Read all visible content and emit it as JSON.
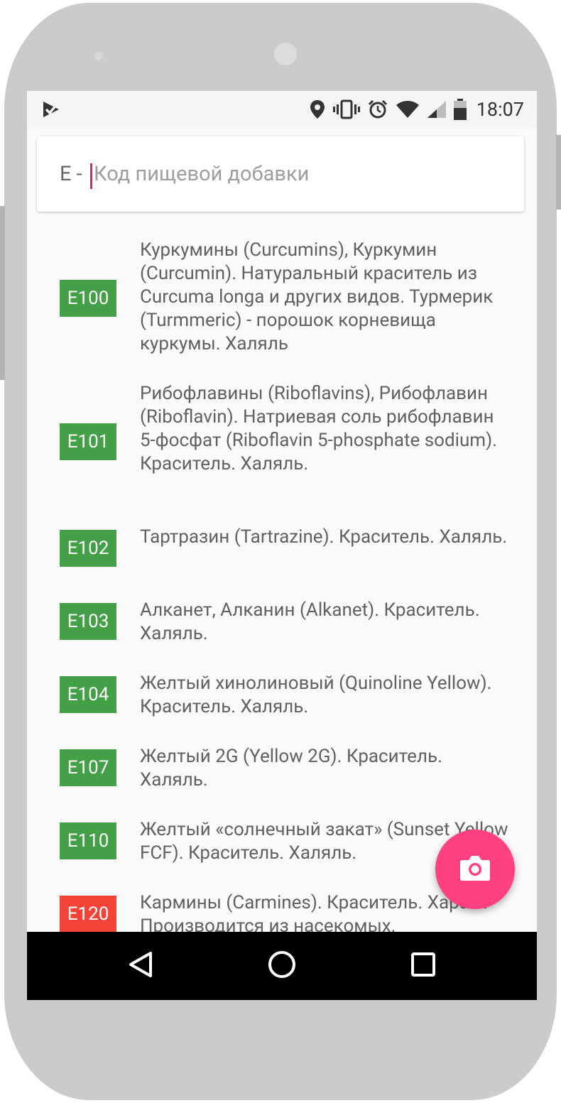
{
  "status_bar": {
    "time": "18:07",
    "icons": [
      "notification-check-icon",
      "location-icon",
      "vibrate-icon",
      "alarm-icon",
      "wifi-icon",
      "signal-icon",
      "battery-icon"
    ]
  },
  "search": {
    "prefix": "E -",
    "placeholder": "Код пищевой добавки",
    "value": ""
  },
  "colors": {
    "halal": "#43a047",
    "haram": "#f44336",
    "accent": "#ff4081",
    "caret": "#e91e63"
  },
  "items": [
    {
      "code": "E100",
      "status": "halal",
      "description": "Куркумины (Curcumins), Куркумин (Curcumin). Натуральный краситель из Curcuma longa и других видов. Турмерик (Turmmeric) - порошок корневища куркумы. Халяль"
    },
    {
      "code": "E101",
      "status": "halal",
      "description": "Рибофлавины (Riboflavins), Рибофлавин (Riboflavin). Натриевая соль рибофлавин 5-фосфат (Riboflavin 5-phosphate sodium). Краситель. Халяль."
    },
    {
      "code": "E102",
      "status": "halal",
      "description": "Тартразин (Tartrazine). Краситель. Халяль."
    },
    {
      "code": "E103",
      "status": "halal",
      "description": "Алканет, Алканин (Alkanet). Краситель. Халяль."
    },
    {
      "code": "E104",
      "status": "halal",
      "description": "Желтый хинолиновый (Quinoline Yellow). Краситель. Халяль."
    },
    {
      "code": "E107",
      "status": "halal",
      "description": "Желтый 2G (Yellow 2G). Краситель. Халяль."
    },
    {
      "code": "E110",
      "status": "halal",
      "description": "Желтый «солнечный закат» (Sunset Yellow FCF). Краситель. Халяль."
    },
    {
      "code": "E120",
      "status": "haram",
      "description": "Кармины (Carmines). Краситель. Харам. Производится из насекомых."
    }
  ],
  "fab": {
    "icon": "camera-icon"
  },
  "nav_bar": {
    "icons": [
      "back-icon",
      "home-icon",
      "recents-icon"
    ]
  }
}
